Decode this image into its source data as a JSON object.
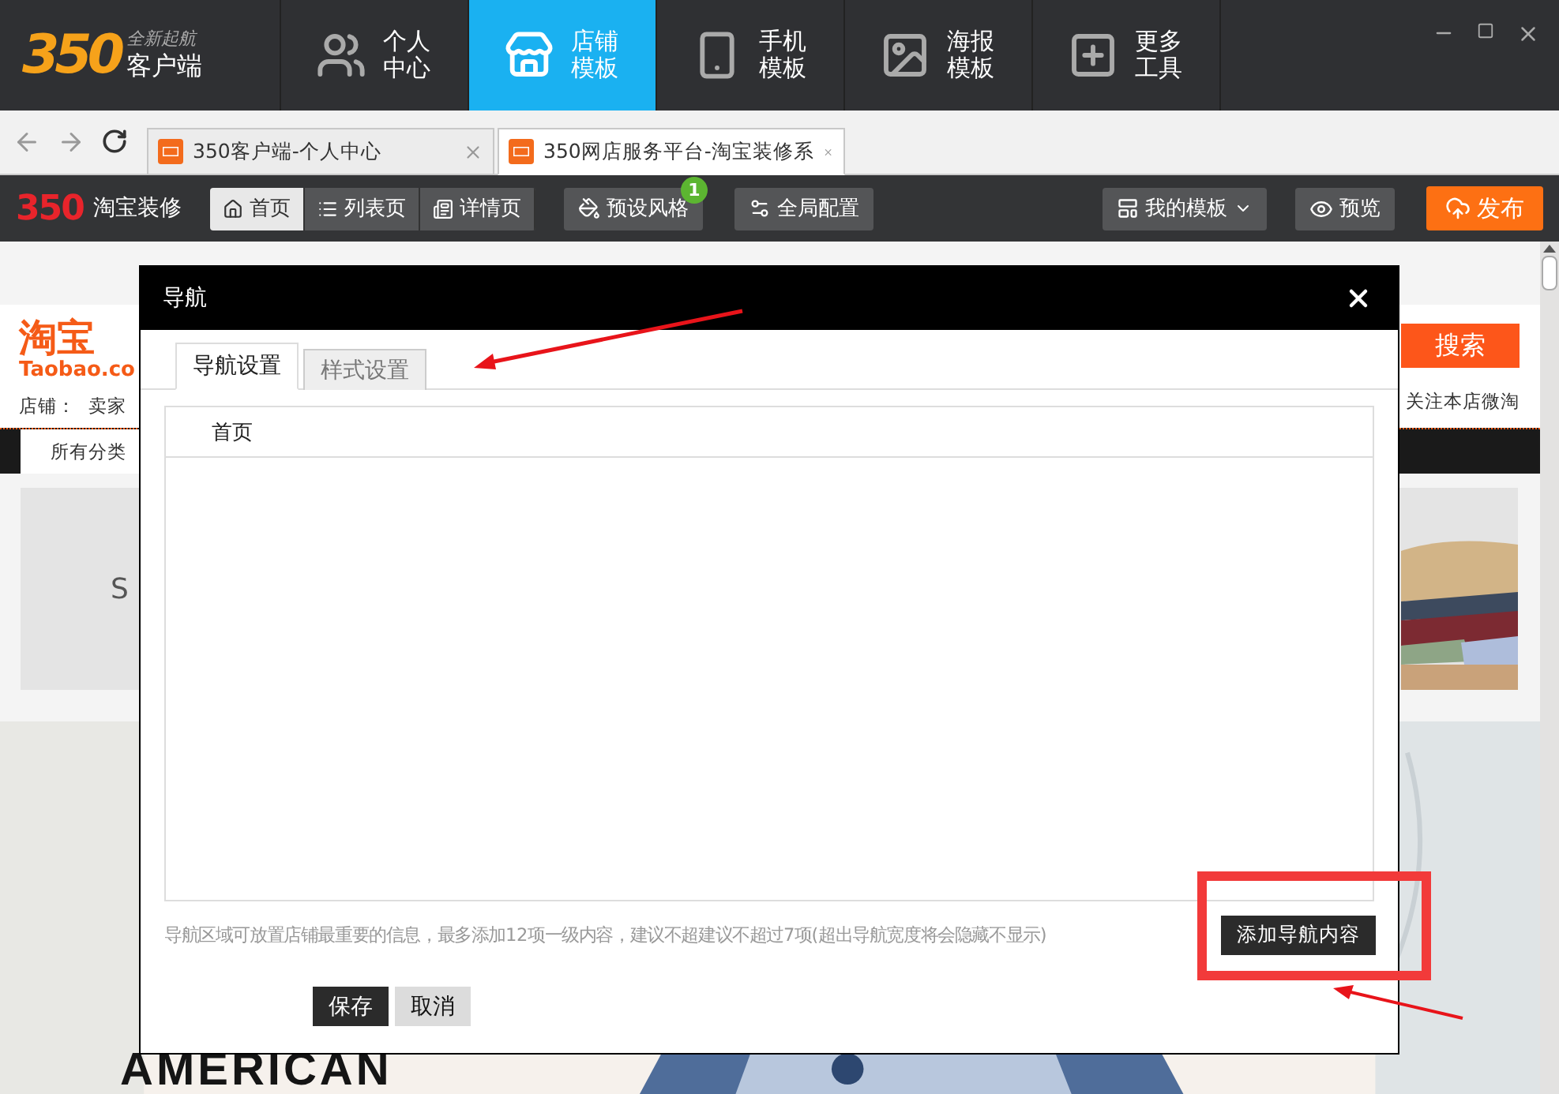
{
  "app_bar": {
    "logo": {
      "digits": "350",
      "tagline": "全新起航",
      "name": "客户端"
    },
    "nav": [
      {
        "label": "个人中心",
        "kind": "people",
        "selected": false
      },
      {
        "label": "店铺模板",
        "kind": "store",
        "selected": true
      },
      {
        "label": "手机模板",
        "kind": "phone",
        "selected": false
      },
      {
        "label": "海报模板",
        "kind": "poster",
        "selected": false
      },
      {
        "label": "更多工具",
        "kind": "plus",
        "selected": false
      }
    ]
  },
  "browser": {
    "tabs": [
      {
        "title": "350客户端-个人中心",
        "selected": false
      },
      {
        "title": "350网店服务平台-淘宝装修系",
        "selected": true
      }
    ]
  },
  "editor_toolbar": {
    "logo_digits": "350",
    "logo_text": "淘宝装修",
    "pages": [
      {
        "label": "首页",
        "selected": true
      },
      {
        "label": "列表页",
        "selected": false
      },
      {
        "label": "详情页",
        "selected": false
      }
    ],
    "style_button": {
      "label": "预设风格",
      "badge": "1"
    },
    "global_button": "全局配置",
    "templates_button": "我的模板",
    "preview_button": "预览",
    "publish_button": "发布"
  },
  "store_page": {
    "logo_cn": "淘宝",
    "logo_en": "Taobao.co",
    "shop_label": "店铺：",
    "shop_name": "卖家",
    "search_button": "搜索",
    "follow_link": "关注本店微淘",
    "category": "所有分类",
    "banner_text": "S",
    "hero_text": "AMERICAN"
  },
  "dialog": {
    "title": "导航",
    "tabs": [
      {
        "label": "导航设置",
        "selected": true
      },
      {
        "label": "样式设置",
        "selected": false
      }
    ],
    "nav_items": [
      "首页"
    ],
    "hint": "导航区域可放置店铺最重要的信息，最多添加12项一级内容，建议不超建议不超过7项(超出导航宽度将会隐藏不显示)",
    "add_button": "添加导航内容",
    "save_button": "保存",
    "cancel_button": "取消"
  }
}
